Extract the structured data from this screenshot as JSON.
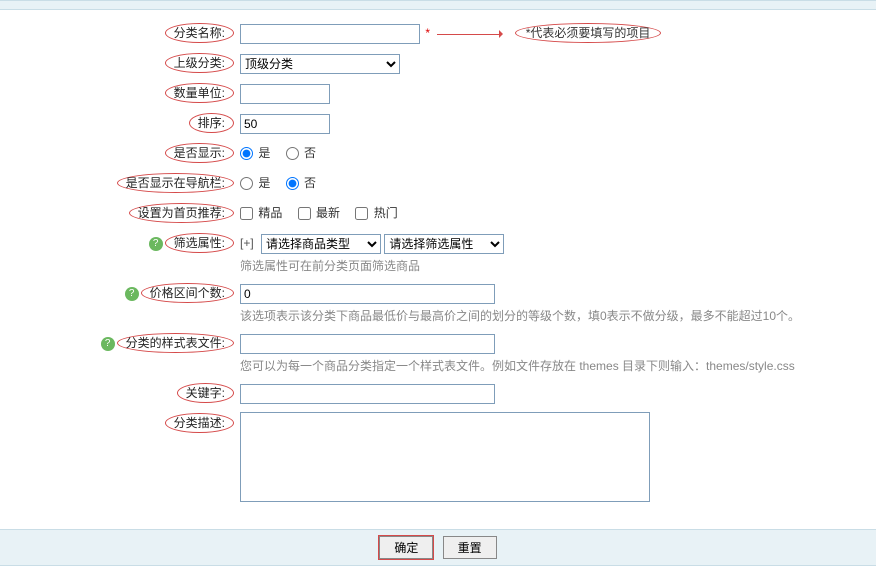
{
  "legend_text": "*代表必须要填写的项目",
  "fields": {
    "name": {
      "label": "分类名称:",
      "value": ""
    },
    "parent": {
      "label": "上级分类:",
      "selected": "顶级分类"
    },
    "unit": {
      "label": "数量单位:",
      "value": ""
    },
    "sort": {
      "label": "排序:",
      "value": "50"
    },
    "display": {
      "label": "是否显示:",
      "yes": "是",
      "no": "否",
      "value": "yes"
    },
    "nav": {
      "label": "是否显示在导航栏:",
      "yes": "是",
      "no": "否",
      "value": "no"
    },
    "home": {
      "label": "设置为首页推荐:",
      "opt1": "精品",
      "opt2": "最新",
      "opt3": "热门"
    },
    "filter": {
      "label": "筛选属性:",
      "plus": "[+]",
      "sel1": "请选择商品类型",
      "sel2": "请选择筛选属性",
      "hint": "筛选属性可在前分类页面筛选商品"
    },
    "price": {
      "label": "价格区间个数:",
      "value": "0",
      "hint": "该选项表示该分类下商品最低价与最高价之间的划分的等级个数，填0表示不做分级，最多不能超过10个。"
    },
    "style": {
      "label": "分类的样式表文件:",
      "value": "",
      "hint": "您可以为每一个商品分类指定一个样式表文件。例如文件存放在 themes 目录下则输入：themes/style.css"
    },
    "keywords": {
      "label": "关键字:",
      "value": ""
    },
    "desc": {
      "label": "分类描述:",
      "value": ""
    }
  },
  "buttons": {
    "ok": "确定",
    "reset": "重置"
  }
}
